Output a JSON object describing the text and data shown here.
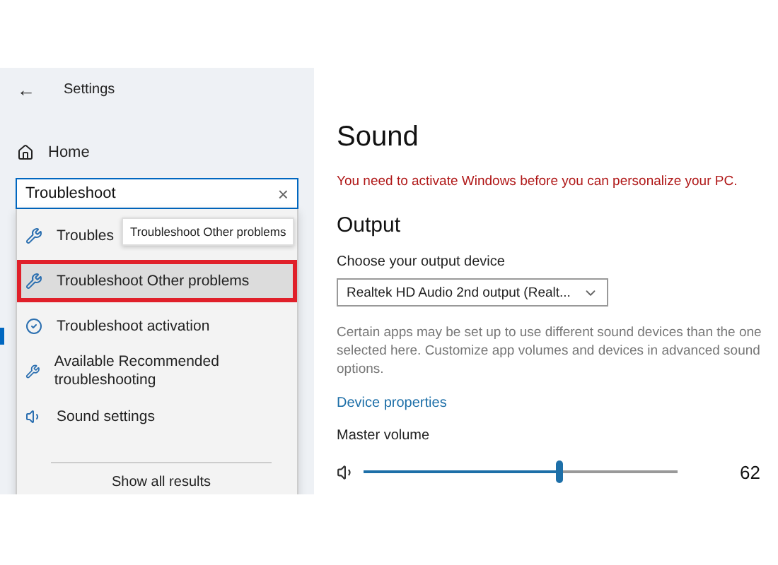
{
  "window": {
    "title": "Settings",
    "back": "←"
  },
  "sidebar": {
    "home": "Home",
    "search": {
      "value": "Troubleshoot",
      "clear": "×"
    },
    "results": [
      {
        "kind": "wrench",
        "label": "Troubles",
        "selected": false
      },
      {
        "kind": "wrench",
        "label": "Troubleshoot Other problems",
        "selected": true
      },
      {
        "kind": "check",
        "label": "Troubleshoot activation",
        "selected": false
      },
      {
        "kind": "wrench",
        "label": "Available Recommended troubleshooting",
        "selected": false
      },
      {
        "kind": "speaker",
        "label": "Sound settings",
        "selected": false
      }
    ],
    "show_all": "Show all results",
    "tooltip": "Troubleshoot Other problems"
  },
  "main": {
    "title": "Sound",
    "warning": "You need to activate Windows before you can personalize your PC.",
    "section": "Output",
    "device_label": "Choose your output device",
    "device": "Realtek HD Audio 2nd output (Realt...",
    "description": "Certain apps may be set up to use different sound devices than the one selected here. Customize app volumes and devices in advanced sound options.",
    "link": "Device properties",
    "volume_label": "Master volume",
    "volume": {
      "level": 0.62,
      "reading": "62"
    }
  }
}
